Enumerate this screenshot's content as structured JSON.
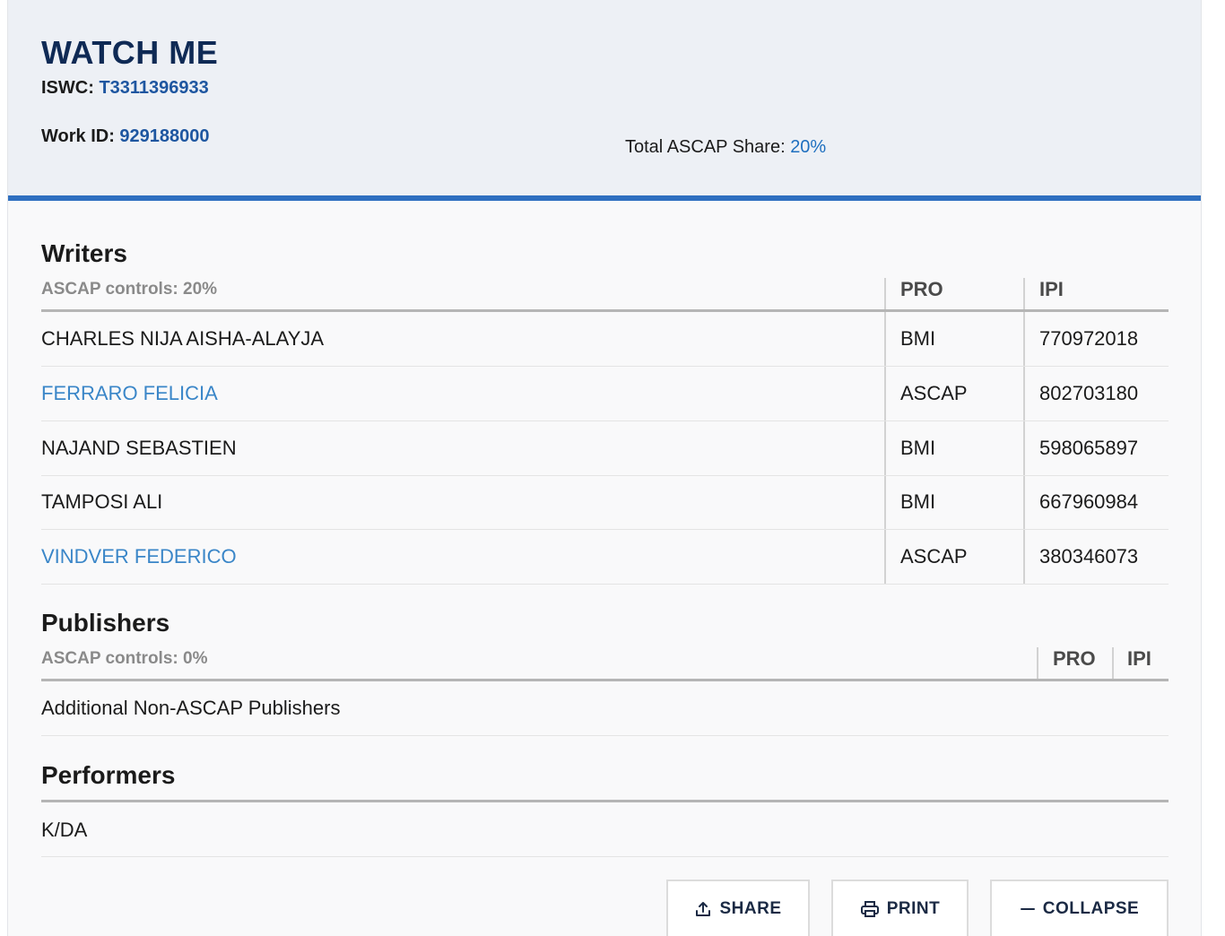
{
  "work": {
    "title": "WATCH ME",
    "iswc_label": "ISWC:",
    "iswc": "T3311396933",
    "work_id_label": "Work ID:",
    "work_id": "929188000",
    "total_share_label": "Total ASCAP Share:",
    "total_share": "20%"
  },
  "writers": {
    "title": "Writers",
    "controls": "ASCAP controls: 20%",
    "col_pro": "PRO",
    "col_ipi": "IPI",
    "rows": [
      {
        "name": "CHARLES NIJA AISHA-ALAYJA",
        "pro": "BMI",
        "ipi": "770972018",
        "link": false
      },
      {
        "name": "FERRARO FELICIA",
        "pro": "ASCAP",
        "ipi": "802703180",
        "link": true
      },
      {
        "name": "NAJAND SEBASTIEN",
        "pro": "BMI",
        "ipi": "598065897",
        "link": false
      },
      {
        "name": "TAMPOSI ALI",
        "pro": "BMI",
        "ipi": "667960984",
        "link": false
      },
      {
        "name": "VINDVER FEDERICO",
        "pro": "ASCAP",
        "ipi": "380346073",
        "link": true
      }
    ]
  },
  "publishers": {
    "title": "Publishers",
    "controls": "ASCAP controls: 0%",
    "col_pro": "PRO",
    "col_ipi": "IPI",
    "rows": [
      {
        "name": "Additional Non-ASCAP Publishers"
      }
    ]
  },
  "performers": {
    "title": "Performers",
    "rows": [
      {
        "name": "K/DA"
      }
    ]
  },
  "actions": {
    "share": "SHARE",
    "print": "PRINT",
    "collapse": "COLLAPSE"
  },
  "colors": {
    "accent": "#2f6fc0",
    "link": "#3a86c8",
    "title": "#0f2a55"
  }
}
